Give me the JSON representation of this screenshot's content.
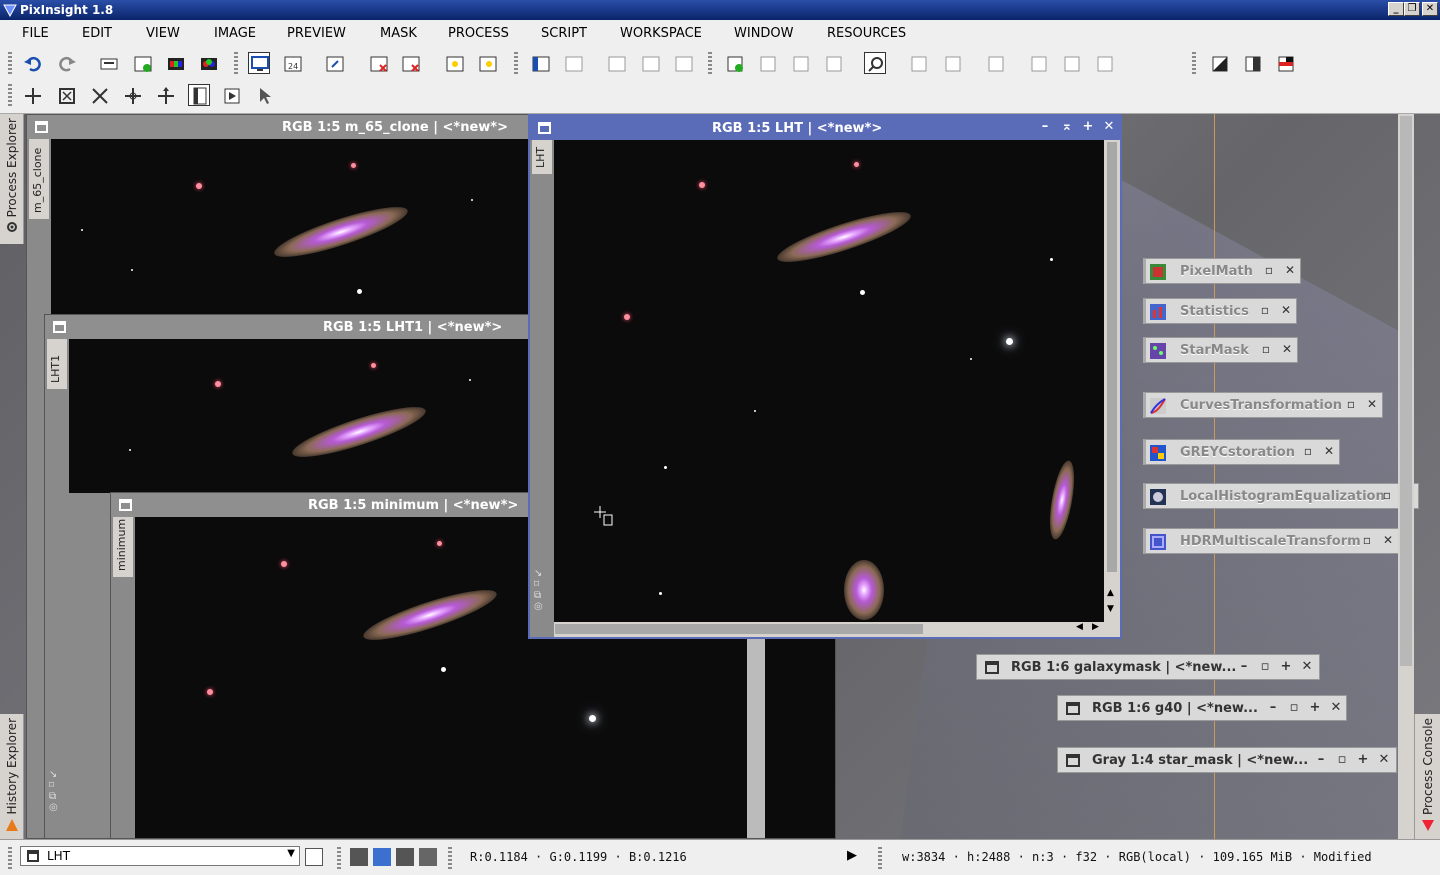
{
  "app": {
    "title": "PixInsight 1.8"
  },
  "menu": [
    "FILE",
    "EDIT",
    "VIEW",
    "IMAGE",
    "PREVIEW",
    "MASK",
    "PROCESS",
    "SCRIPT",
    "WORKSPACE",
    "WINDOW",
    "RESOURCES"
  ],
  "side_tabs": {
    "process_explorer": "Process Explorer",
    "history_explorer": "History Explorer",
    "process_console": "Process Console"
  },
  "windows": {
    "m65_clone": {
      "title": "RGB 1:5 m_65_clone | <*new*>",
      "tab": "m_65_clone"
    },
    "lht1": {
      "title": "RGB 1:5 LHT1 | <*new*>",
      "tab": "LHT1"
    },
    "minimum": {
      "title": "RGB 1:5 minimum | <*new*>",
      "tab": "minimum"
    },
    "lht": {
      "title": "RGB 1:5 LHT | <*new*>",
      "tab": "LHT"
    }
  },
  "process_icons": [
    "PixelMath",
    "Statistics",
    "StarMask",
    "CurvesTransformation",
    "GREYCstoration",
    "LocalHistogramEqualization",
    "HDRMultiscaleTransform"
  ],
  "minimized": [
    "RGB 1:6 galaxymask | <*new...",
    "RGB 1:6 g40 | <*new...",
    "Gray 1:4 star_mask | <*new..."
  ],
  "status": {
    "view_select": "LHT",
    "rgb_readout": "R:0.1184 · G:0.1199 · B:0.1216",
    "image_info": "w:3834 · h:2488 · n:3 · f32 · RGB(local) · 109.165 MiB · Modified"
  },
  "colors": {
    "title_bar": "#0a246a",
    "active_window": "#5a6bb8",
    "inactive_window": "#8f8f8f"
  }
}
